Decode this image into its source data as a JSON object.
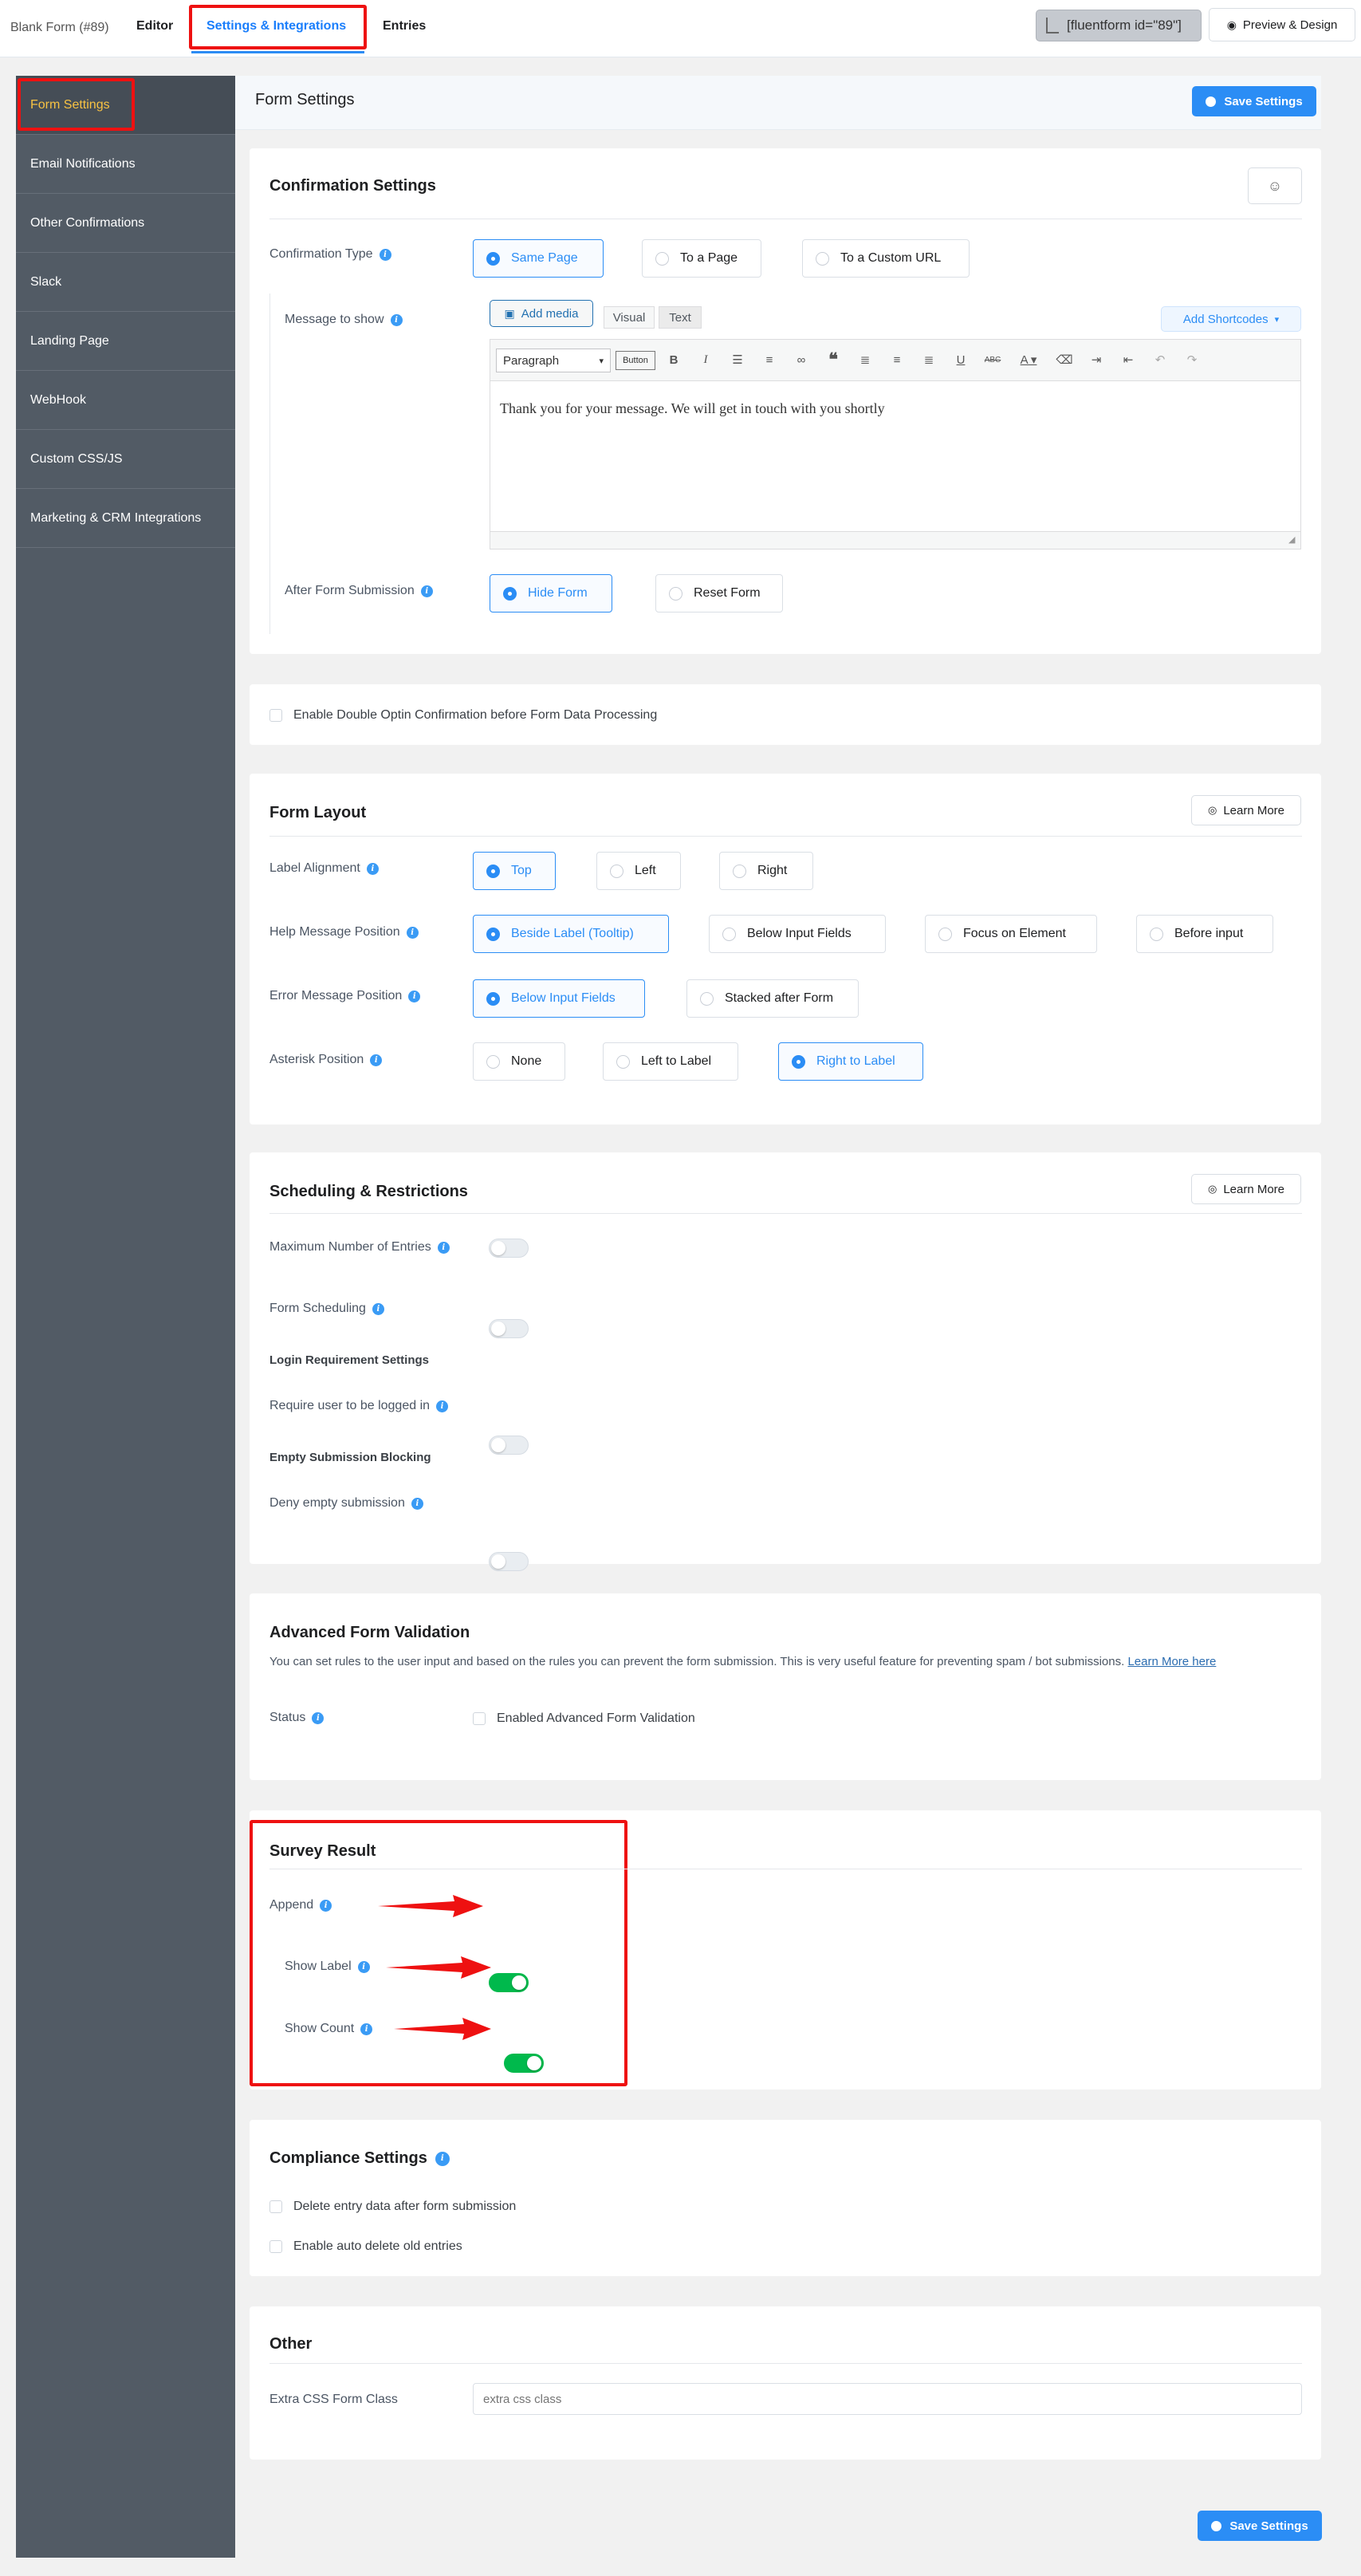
{
  "topbar": {
    "form_title": "Blank Form (#89)",
    "editor": "Editor",
    "settings_tab": "Settings & Integrations",
    "entries": "Entries",
    "shortcode": "[fluentform id=\"89\"]",
    "preview": "Preview & Design"
  },
  "sidebar": {
    "items": [
      {
        "label": "Form Settings"
      },
      {
        "label": "Email Notifications"
      },
      {
        "label": "Other Confirmations"
      },
      {
        "label": "Slack"
      },
      {
        "label": "Landing Page"
      },
      {
        "label": "WebHook"
      },
      {
        "label": "Custom CSS/JS"
      },
      {
        "label": "Marketing & CRM Integrations"
      }
    ]
  },
  "header": {
    "title": "Form Settings",
    "save": "Save Settings"
  },
  "confirmation": {
    "title": "Confirmation Settings",
    "type_label": "Confirmation Type",
    "types": [
      "Same Page",
      "To a Page",
      "To a Custom URL"
    ],
    "message_label": "Message to show",
    "add_media": "Add media",
    "visual": "Visual",
    "text": "Text",
    "add_shortcodes": "Add Shortcodes",
    "paragraph": "Paragraph",
    "button": "Button",
    "message": "Thank you for your message. We will get in touch with you shortly",
    "after_label": "After Form Submission",
    "after_options": [
      "Hide Form",
      "Reset Form"
    ]
  },
  "double_optin": {
    "label": "Enable Double Optin Confirmation before Form Data Processing"
  },
  "layout": {
    "title": "Form Layout",
    "learn_more": "Learn More",
    "label_alignment": "Label Alignment",
    "label_options": [
      "Top",
      "Left",
      "Right"
    ],
    "help_position": "Help Message Position",
    "help_options": [
      "Beside Label (Tooltip)",
      "Below Input Fields",
      "Focus on Element",
      "Before input"
    ],
    "error_position": "Error Message Position",
    "error_options": [
      "Below Input Fields",
      "Stacked after Form"
    ],
    "asterisk_position": "Asterisk Position",
    "asterisk_options": [
      "None",
      "Left to Label",
      "Right to Label"
    ]
  },
  "scheduling": {
    "title": "Scheduling & Restrictions",
    "learn_more": "Learn More",
    "max_entries": "Maximum Number of Entries",
    "form_scheduling": "Form Scheduling",
    "login_heading": "Login Requirement Settings",
    "require_login": "Require user to be logged in",
    "empty_heading": "Empty Submission Blocking",
    "deny_empty": "Deny empty submission"
  },
  "validation": {
    "title": "Advanced Form Validation",
    "description": "You can set rules to the user input and based on the rules you can prevent the form submission. This is very useful feature for preventing spam / bot submissions.",
    "learn_link": "Learn More here",
    "status_label": "Status",
    "checkbox_label": "Enabled Advanced Form Validation"
  },
  "survey": {
    "title": "Survey Result",
    "append": "Append",
    "show_label": "Show Label",
    "show_count": "Show Count"
  },
  "compliance": {
    "title": "Compliance Settings",
    "delete_entry": "Delete entry data after form submission",
    "auto_delete": "Enable auto delete old entries"
  },
  "other": {
    "title": "Other",
    "css_label": "Extra CSS Form Class",
    "css_placeholder": "extra css class"
  },
  "footer": {
    "save": "Save Settings"
  },
  "colors": {
    "accent": "#2b8df5",
    "toggle_on": "#00b94c",
    "highlight": "#e11111",
    "sidebar": "#525b65"
  }
}
